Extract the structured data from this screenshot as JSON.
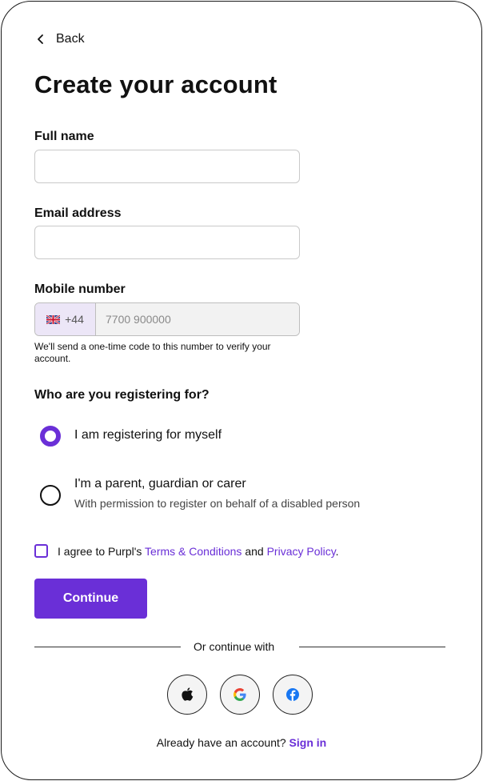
{
  "nav": {
    "back_label": "Back",
    "back_icon": "chevron-left-icon"
  },
  "page": {
    "title": "Create your account"
  },
  "form": {
    "full_name": {
      "label": "Full name",
      "value": "",
      "placeholder": ""
    },
    "email": {
      "label": "Email address",
      "value": "",
      "placeholder": ""
    },
    "mobile": {
      "label": "Mobile number",
      "country_flag": "uk-flag-icon",
      "country_code": "+44",
      "value": "",
      "placeholder": "7700 900000",
      "hint": "We'll send a one-time code to this number to verify your account."
    }
  },
  "registering": {
    "question": "Who are you registering for?",
    "options": [
      {
        "title": "I am registering for myself",
        "subtitle": "",
        "selected": true
      },
      {
        "title": "I'm a parent, guardian or carer",
        "subtitle": "With permission to register on behalf of a disabled person",
        "selected": false
      }
    ]
  },
  "agreement": {
    "checked": false,
    "prefix": "I agree to Purpl's",
    "terms_link": "Terms & Conditions",
    "joiner": "and",
    "privacy_link": "Privacy Policy",
    "suffix": "."
  },
  "actions": {
    "continue_label": "Continue"
  },
  "social": {
    "divider_label": "Or continue with",
    "providers": [
      {
        "name": "apple-icon"
      },
      {
        "name": "google-icon"
      },
      {
        "name": "facebook-icon"
      }
    ]
  },
  "footer": {
    "prompt": "Already have an account?",
    "signin_link": "Sign in"
  },
  "colors": {
    "accent": "#6a2fd7",
    "prefix_bg": "#ece6f7",
    "text": "#111111"
  }
}
